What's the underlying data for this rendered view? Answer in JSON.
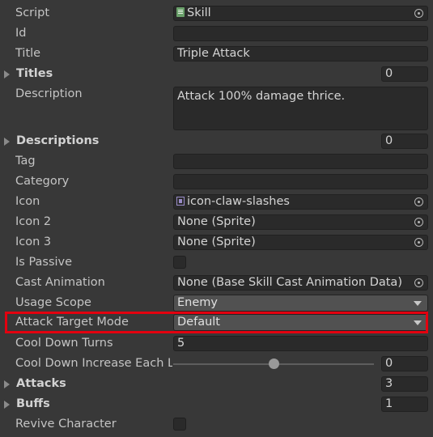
{
  "inspector": {
    "script": {
      "label": "Script",
      "value": "Skill",
      "icon": "script-icon"
    },
    "id": {
      "label": "Id",
      "value": ""
    },
    "title": {
      "label": "Title",
      "value": "Triple Attack"
    },
    "titles": {
      "label": "Titles",
      "count": "0"
    },
    "description": {
      "label": "Description",
      "value": "Attack 100% damage thrice."
    },
    "descriptions": {
      "label": "Descriptions",
      "count": "0"
    },
    "tag": {
      "label": "Tag",
      "value": ""
    },
    "category": {
      "label": "Category",
      "value": ""
    },
    "icon": {
      "label": "Icon",
      "value": "icon-claw-slashes",
      "icon": "sprite-icon"
    },
    "icon2": {
      "label": "Icon 2",
      "value": "None (Sprite)"
    },
    "icon3": {
      "label": "Icon 3",
      "value": "None (Sprite)"
    },
    "is_passive": {
      "label": "Is Passive",
      "checked": false
    },
    "cast_animation": {
      "label": "Cast Animation",
      "value": "None (Base Skill Cast Animation Data)"
    },
    "usage_scope": {
      "label": "Usage Scope",
      "value": "Enemy"
    },
    "attack_target_mode": {
      "label": "Attack Target Mode",
      "value": "Default"
    },
    "cool_down_turns": {
      "label": "Cool Down Turns",
      "value": "5"
    },
    "cool_down_increase": {
      "label": "Cool Down Increase Each Level",
      "value": "0",
      "slider_fraction": 0.5
    },
    "attacks": {
      "label": "Attacks",
      "count": "3"
    },
    "buffs": {
      "label": "Buffs",
      "count": "1"
    },
    "revive_character": {
      "label": "Revive Character",
      "checked": false
    }
  },
  "colors": {
    "background": "#383838",
    "field": "#2a2a2a",
    "highlight": "#e3000f"
  }
}
